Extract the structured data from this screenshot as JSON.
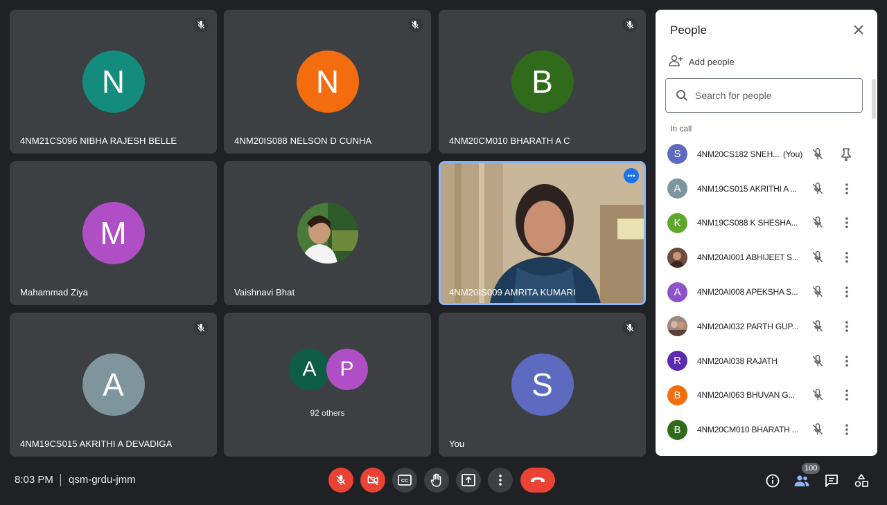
{
  "tiles": [
    {
      "name": "4NM21CS096 NIBHA RAJESH BELLE",
      "initial": "N",
      "color": "#138b7d",
      "muted": true
    },
    {
      "name": "4NM20IS088 NELSON D CUNHA",
      "initial": "N",
      "color": "#f36c0e",
      "muted": true
    },
    {
      "name": "4NM20CM010 BHARATH A C",
      "initial": "B",
      "color": "#2f6b1a",
      "muted": true
    },
    {
      "name": "Mahammad Ziya",
      "initial": "M",
      "color": "#b04ec6",
      "muted": false
    },
    {
      "name": "Vaishnavi Bhat",
      "muted": false
    },
    {
      "name": "4NM20IS009 AMRITA KUMARI",
      "muted": false
    },
    {
      "name": "4NM19CS015 AKRITHI A DEVADIGA",
      "initial": "A",
      "color": "#7f959e",
      "muted": true
    },
    {
      "others_label": "92 others",
      "a_initial": "A",
      "p_initial": "P"
    },
    {
      "name": "You",
      "initial": "S",
      "color": "#5c6bc0",
      "muted": true
    }
  ],
  "panel": {
    "title": "People",
    "add_people": "Add people",
    "search_placeholder": "Search for people",
    "in_call": "In call",
    "you_label": "(You)",
    "participants": [
      {
        "name": "4NM20CS182 SNEH...",
        "initial": "S",
        "color": "#5c6bc0",
        "you": true
      },
      {
        "name": "4NM19CS015 AKRITHI A ...",
        "initial": "A",
        "color": "#7f959e"
      },
      {
        "name": "4NM19CS088 K SHESHA...",
        "initial": "K",
        "color": "#5fa72c"
      },
      {
        "name": "4NM20AI001 ABHIJEET S...",
        "initial": "",
        "color": "#6d4c41"
      },
      {
        "name": "4NM20AI008 APEKSHA S...",
        "initial": "A",
        "color": "#8e52c9"
      },
      {
        "name": "4NM20AI032 PARTH GUP...",
        "initial": "",
        "color": "#8d6e63"
      },
      {
        "name": "4NM20AI038 RAJATH",
        "initial": "R",
        "color": "#5b2ab0"
      },
      {
        "name": "4NM20AI063 BHUVAN G...",
        "initial": "B",
        "color": "#f36c0e"
      },
      {
        "name": "4NM20CM010 BHARATH ...",
        "initial": "B",
        "color": "#2f6b1a"
      }
    ]
  },
  "bottom": {
    "time": "8:03 PM",
    "meeting_code": "qsm-grdu-jmm",
    "participant_count": "100"
  }
}
